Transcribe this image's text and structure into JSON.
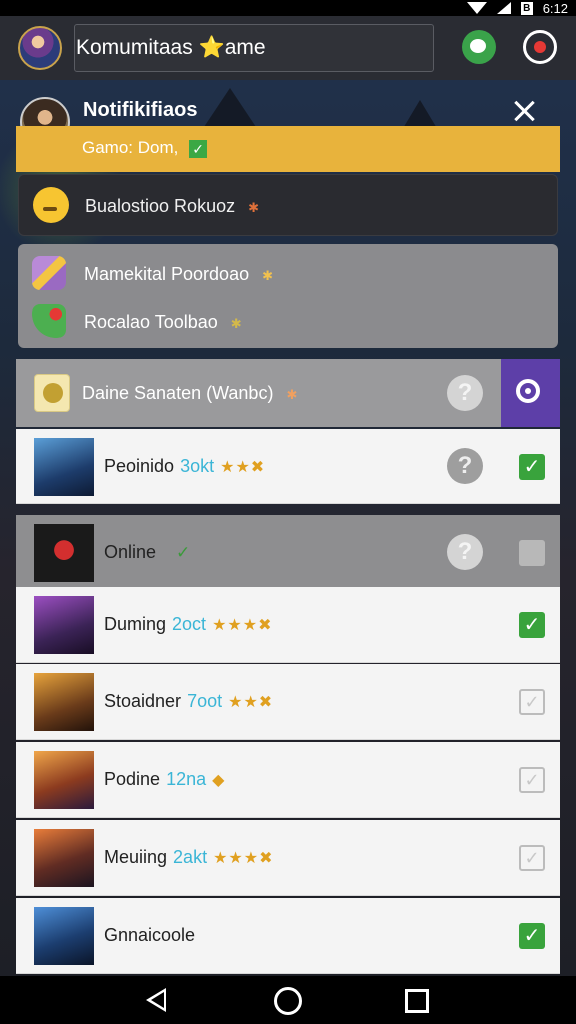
{
  "status_bar": {
    "time": "6:12"
  },
  "app_bar": {
    "title": "Komumitaas ⭐ame"
  },
  "notification": {
    "title": "Notifikifiaos",
    "banner_text": "Gamo: Dom,",
    "banner_check": "✓",
    "emoji_row_text": "Bualostioo Rokuoz",
    "grey_rows": [
      {
        "text": "Mamekital Poordoao",
        "icon": "wand-icon"
      },
      {
        "text": "Rocalao Toolbao",
        "icon": "leaf-icon"
      }
    ]
  },
  "settings_row": {
    "text": "Daine Sanaten (Wanbc)",
    "help": "?"
  },
  "list": [
    {
      "name": "Peoinido",
      "extra": "3okt",
      "glyphs": "★★✖",
      "help": "?",
      "checked": true,
      "thumb": "t1"
    },
    {
      "name": "Online",
      "extra": "",
      "glyphs": "",
      "status_check": "✓",
      "help": "?",
      "checked": false,
      "disabled": true,
      "thumb": "t2"
    },
    {
      "name": "Duming",
      "extra": "2oct",
      "glyphs": "★★★✖",
      "checked": true,
      "thumb": "t3"
    },
    {
      "name": "Stoaidner",
      "extra": "7oot",
      "glyphs": "★★✖",
      "checked": false,
      "thumb": "t4"
    },
    {
      "name": "Podine",
      "extra": "12na",
      "glyphs": "◆",
      "checked": false,
      "thumb": "t5"
    },
    {
      "name": "Meuiing",
      "extra": "2akt",
      "glyphs": "★★★✖",
      "checked": false,
      "thumb": "t6"
    },
    {
      "name": "Gnnaicoole",
      "extra": "",
      "glyphs": "",
      "checked": true,
      "thumb": "t7"
    }
  ],
  "check_glyph": "✓"
}
